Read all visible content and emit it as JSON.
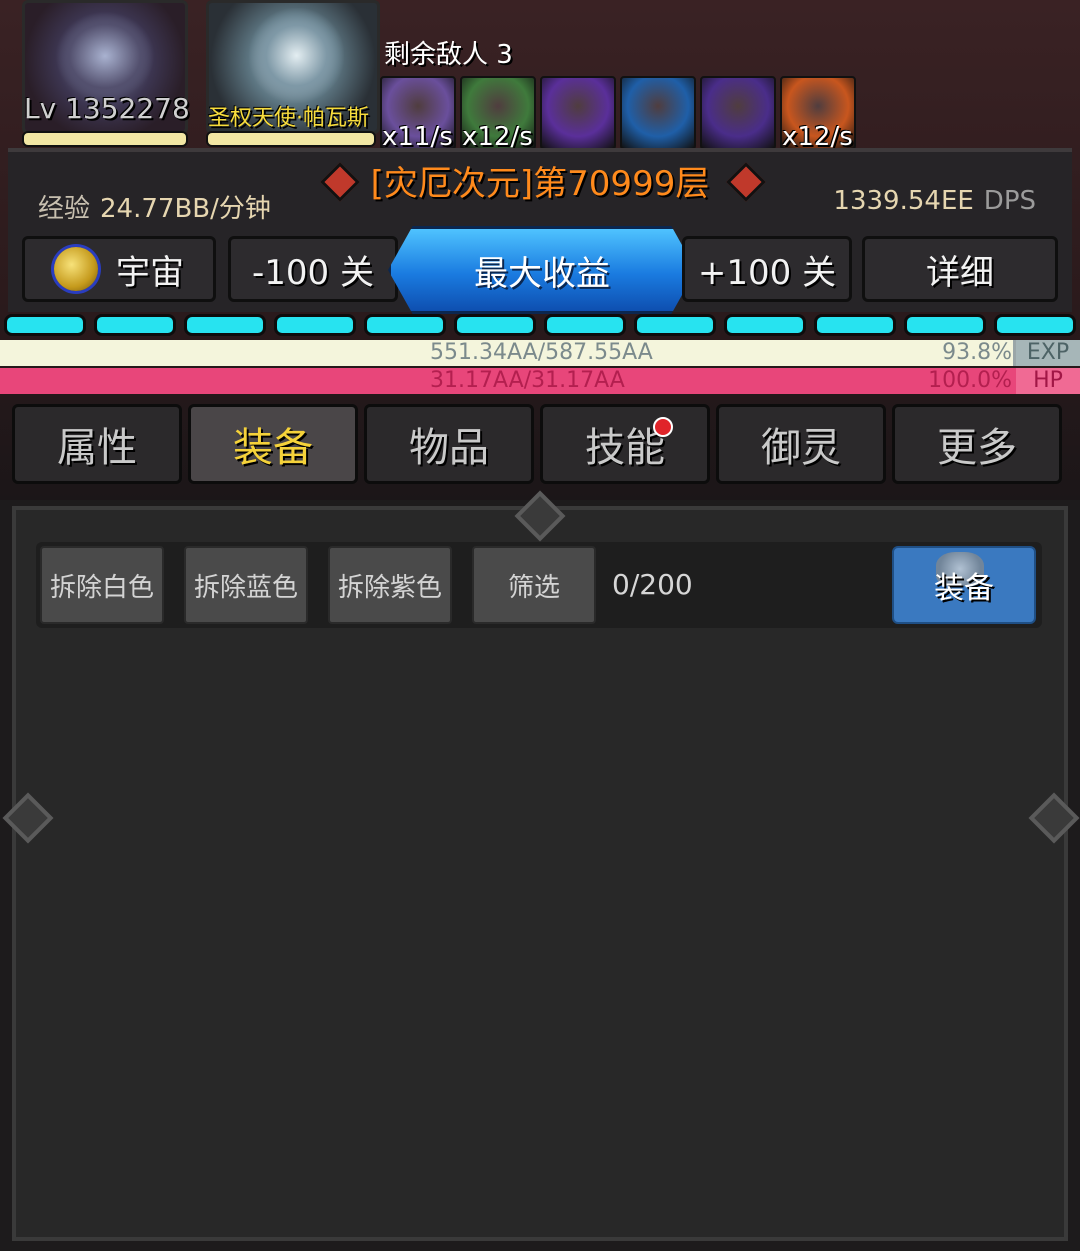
{
  "player": {
    "level": "Lv 1352278",
    "hero_name": "圣权天使·帕瓦斯"
  },
  "enemies_remaining": "剩余敌人 3",
  "skills": [
    {
      "icon": "ghost-skull-icon",
      "rate": "x11/s",
      "color": "#6a4f9c"
    },
    {
      "icon": "green-scythe-icon",
      "rate": "x12/s",
      "color": "#3f7a3c"
    },
    {
      "icon": "purple-orb-icon",
      "rate": "",
      "color": "#5a2f9a"
    },
    {
      "icon": "blue-vortex-icon",
      "rate": "",
      "color": "#1f5fa8"
    },
    {
      "icon": "purple-rune-icon",
      "rate": "",
      "color": "#4a2d8a"
    },
    {
      "icon": "fire-claw-icon",
      "rate": "x12/s",
      "color": "#c8561e"
    }
  ],
  "stage_title": "[灾厄次元]第70999层",
  "exp_rate": {
    "label": "经验",
    "value": "24.77BB/分钟"
  },
  "dps": {
    "value": "1339.54EE",
    "label": "DPS"
  },
  "nav_buttons": {
    "universe": "宇宙",
    "minus": "-100 关",
    "max": "最大收益",
    "plus": "+100 关",
    "detail": "详细"
  },
  "segments_count": 12,
  "exp_bar": {
    "text": "551.34AA/587.55AA",
    "percent": "93.8%",
    "tag": "EXP",
    "fill": 0.938
  },
  "hp_bar": {
    "text": "31.17AA/31.17AA",
    "percent": "100.0%",
    "tag": "HP",
    "fill": 1.0
  },
  "tabs": [
    {
      "label": "属性",
      "active": false
    },
    {
      "label": "装备",
      "active": true
    },
    {
      "label": "物品",
      "active": false
    },
    {
      "label": "技能",
      "active": false,
      "badge": true
    },
    {
      "label": "御灵",
      "active": false
    },
    {
      "label": "更多",
      "active": false
    }
  ],
  "toolbar": {
    "remove_white": "拆除白色",
    "remove_blue": "拆除蓝色",
    "remove_purple": "拆除紫色",
    "filter": "筛选",
    "count": "0/200",
    "equip": "装备"
  }
}
